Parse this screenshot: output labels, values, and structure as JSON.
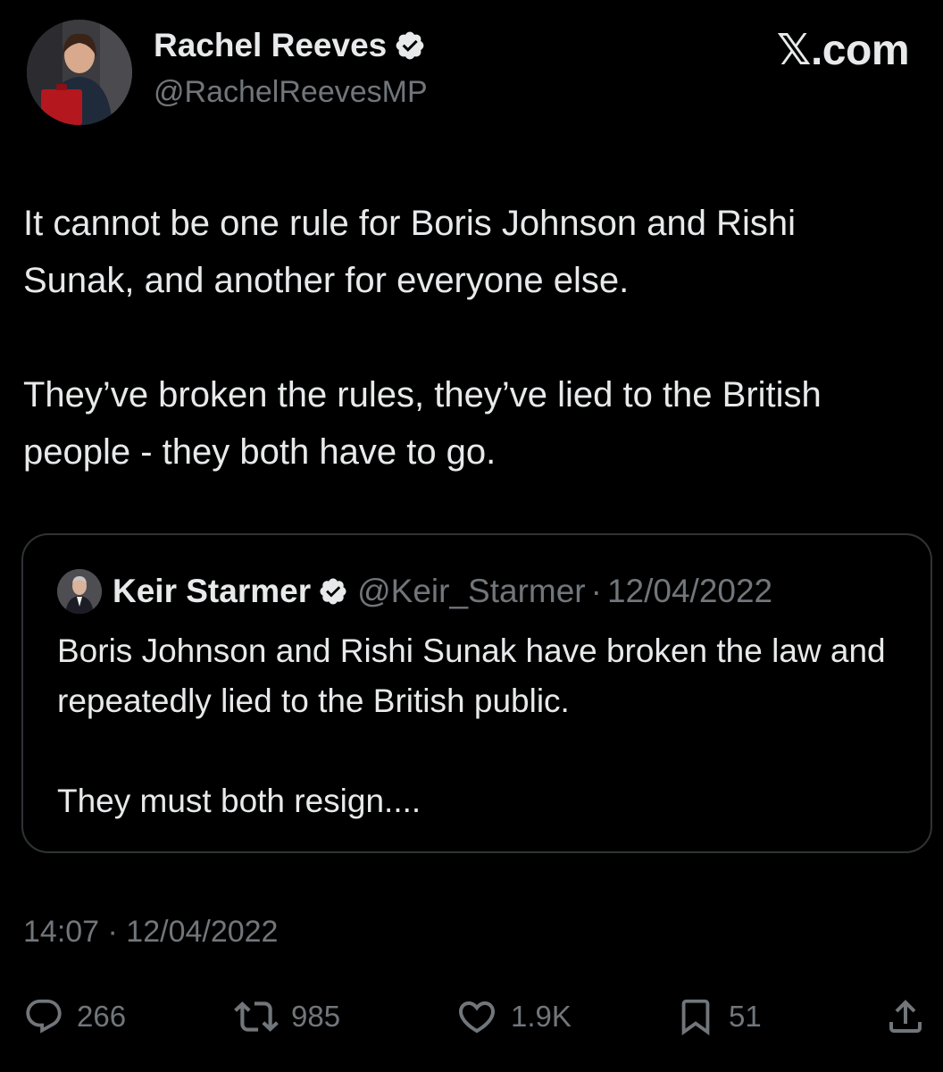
{
  "brand": "𝕏.com",
  "author": {
    "name": "Rachel Reeves",
    "handle": "@RachelReevesMP",
    "verified_icon": "verified-badge-icon"
  },
  "tweet": {
    "paragraphs": [
      "It cannot be one rule for Boris Johnson and Rishi Sunak, and another for everyone else.",
      "They’ve broken the rules, they’ve lied to the British people - they both have to go."
    ],
    "timestamp": "14:07 · 12/04/2022"
  },
  "quote": {
    "name": "Keir Starmer",
    "handle": "@Keir_Starmer",
    "separator": "·",
    "date": "12/04/2022",
    "paragraphs": [
      "Boris Johnson and Rishi Sunak have broken the law and repeatedly lied to the British public.",
      "They must both resign...."
    ]
  },
  "actions": {
    "replies": "266",
    "reposts": "985",
    "likes": "1.9K",
    "bookmarks": "51"
  },
  "colors": {
    "background": "#000000",
    "text_primary": "#e7e9ea",
    "text_secondary": "#71767b",
    "border": "#2f3336",
    "verified": "#e7e9ea"
  }
}
